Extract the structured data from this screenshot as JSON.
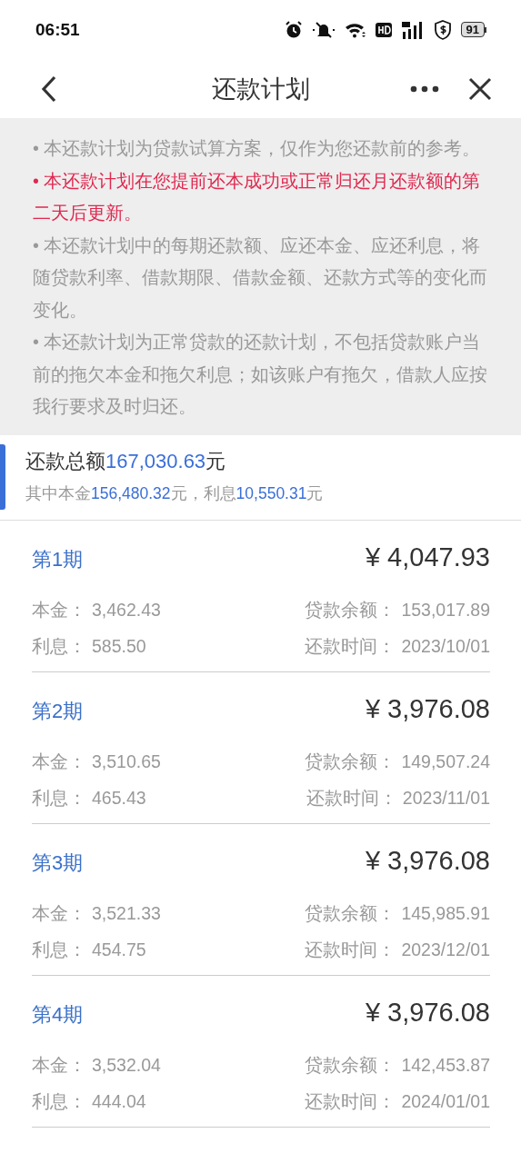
{
  "status_bar": {
    "time": "06:51",
    "battery": "91"
  },
  "nav": {
    "title": "还款计划"
  },
  "notes": [
    {
      "text": "• 本还款计划为贷款试算方案，仅作为您还款前的参考。",
      "highlight": false
    },
    {
      "text": "• 本还款计划在您提前还本成功或正常归还月还款额的第二天后更新。",
      "highlight": true
    },
    {
      "text": "• 本还款计划中的每期还款额、应还本金、应还利息，将随贷款利率、借款期限、借款金额、还款方式等的变化而变化。",
      "highlight": false
    },
    {
      "text": "• 本还款计划为正常贷款的还款计划，不包括贷款账户当前的拖欠本金和拖欠利息；如该账户有拖欠，借款人应按我行要求及时归还。",
      "highlight": false
    }
  ],
  "summary": {
    "total_label": "还款总额",
    "total_amount": "167,030.63",
    "total_unit": "元",
    "principal_label": "其中本金",
    "principal_amount": "156,480.32",
    "principal_unit": "元，",
    "interest_label": "利息",
    "interest_amount": "10,550.31",
    "interest_unit": "元"
  },
  "installments": [
    {
      "period": "第1期",
      "amount": "¥ 4,047.93",
      "principal_label": "本金：",
      "principal": "3,462.43",
      "balance_label": "贷款余额：",
      "balance": "153,017.89",
      "interest_label": "利息：",
      "interest": "585.50",
      "date_label": "还款时间：",
      "date": "2023/10/01"
    },
    {
      "period": "第2期",
      "amount": "¥ 3,976.08",
      "principal_label": "本金：",
      "principal": "3,510.65",
      "balance_label": "贷款余额：",
      "balance": "149,507.24",
      "interest_label": "利息：",
      "interest": "465.43",
      "date_label": "还款时间：",
      "date": "2023/11/01"
    },
    {
      "period": "第3期",
      "amount": "¥ 3,976.08",
      "principal_label": "本金：",
      "principal": "3,521.33",
      "balance_label": "贷款余额：",
      "balance": "145,985.91",
      "interest_label": "利息：",
      "interest": "454.75",
      "date_label": "还款时间：",
      "date": "2023/12/01"
    },
    {
      "period": "第4期",
      "amount": "¥ 3,976.08",
      "principal_label": "本金：",
      "principal": "3,532.04",
      "balance_label": "贷款余额：",
      "balance": "142,453.87",
      "interest_label": "利息：",
      "interest": "444.04",
      "date_label": "还款时间：",
      "date": "2024/01/01"
    }
  ]
}
